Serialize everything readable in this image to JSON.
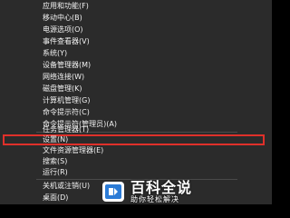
{
  "menu": {
    "items": [
      {
        "label": "应用和功能(F)"
      },
      {
        "label": "移动中心(B)"
      },
      {
        "label": "电源选项(O)"
      },
      {
        "label": "事件查看器(V)"
      },
      {
        "label": "系统(Y)"
      },
      {
        "label": "设备管理器(M)"
      },
      {
        "label": "网络连接(W)"
      },
      {
        "label": "磁盘管理(K)"
      },
      {
        "label": "计算机管理(G)"
      },
      {
        "label": "命令提示符(C)"
      },
      {
        "label": "命令提示符(管理员)(A)"
      },
      {
        "label": "任务管理器(T)"
      },
      {
        "label": "设置(N)"
      },
      {
        "label": "文件资源管理器(E)"
      },
      {
        "label": "搜索(S)"
      },
      {
        "label": "运行(R)"
      },
      {
        "label": "关机或注销(U)"
      },
      {
        "label": "桌面(D)"
      }
    ],
    "highlighted_item": "设置(N)",
    "highlight_color": "#e0302a",
    "background_color": "#2b2b2b",
    "text_color": "#f2f2f2"
  },
  "watermark": {
    "title": "百科全说",
    "subtitle": "助你轻松解决",
    "logo_icon": "baike-logo-icon"
  }
}
